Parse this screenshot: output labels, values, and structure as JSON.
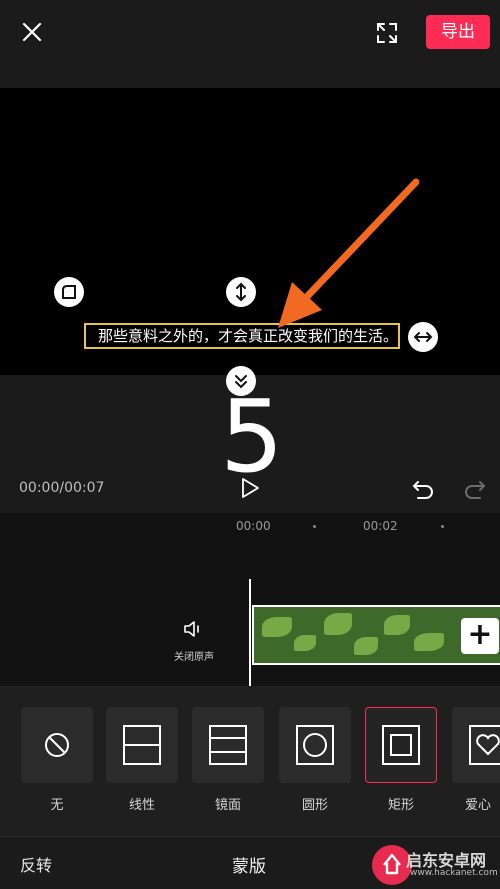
{
  "topbar": {
    "export_label": "导出"
  },
  "preview": {
    "subtitle_text": "那些意料之外的，才会真正改变我们的生活。"
  },
  "overlay": {
    "big_number": "5"
  },
  "player": {
    "timecode": "00:00/00:07"
  },
  "timeline": {
    "ticks": [
      "00:00",
      "00:02"
    ],
    "mute_label": "关闭原声"
  },
  "mask_options": [
    {
      "label": "无",
      "icon": "none-icon"
    },
    {
      "label": "线性",
      "icon": "linear-mask-icon"
    },
    {
      "label": "镜面",
      "icon": "mirror-mask-icon"
    },
    {
      "label": "圆形",
      "icon": "circle-mask-icon"
    },
    {
      "label": "矩形",
      "icon": "rectangle-mask-icon",
      "selected": true
    },
    {
      "label": "爱心",
      "icon": "heart-mask-icon"
    }
  ],
  "bottombar": {
    "invert_label": "反转",
    "title": "蒙版"
  },
  "watermark": {
    "text": "启东安卓网",
    "url": "www.hackanet.com"
  },
  "colors": {
    "accent": "#fe2c55",
    "subtitle_border": "#e8c64a",
    "arrow": "#f26a21"
  }
}
